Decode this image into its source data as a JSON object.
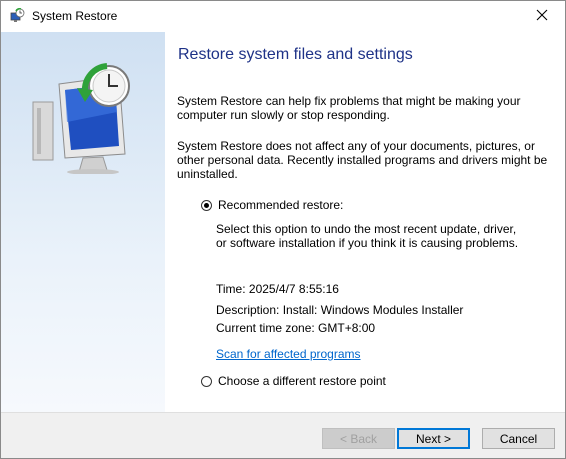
{
  "window": {
    "title": "System Restore",
    "icon": "system-restore-icon",
    "close_glyph": "✕"
  },
  "main": {
    "heading": "Restore system files and settings",
    "para1_line1": "System Restore can help fix problems that might be making your",
    "para1_line2": "computer run slowly or stop responding.",
    "para2_line1": "System Restore does not affect any of your documents, pictures, or",
    "para2_line2": "other personal data. Recently installed programs and drivers might be",
    "para2_line3": "uninstalled."
  },
  "options": {
    "recommended": {
      "label": "Recommended restore:",
      "selected": true,
      "desc_line1": "Select this option to undo the most recent update, driver,",
      "desc_line2": "or software installation if you think it is causing problems."
    },
    "details": {
      "time": "Time: 2025/4/7 8:55:16",
      "description": "Description: Install: Windows Modules Installer",
      "timezone": "Current time zone: GMT+8:00"
    },
    "scan_link": "Scan for affected programs",
    "different": {
      "label": "Choose a different restore point",
      "selected": false
    }
  },
  "buttons": {
    "back": "< Back",
    "next": "Next >",
    "cancel": "Cancel"
  },
  "colors": {
    "heading": "#1e3287",
    "link": "#0066cc",
    "accent": "#0078d7",
    "panel_top": "#cfe0f2"
  }
}
